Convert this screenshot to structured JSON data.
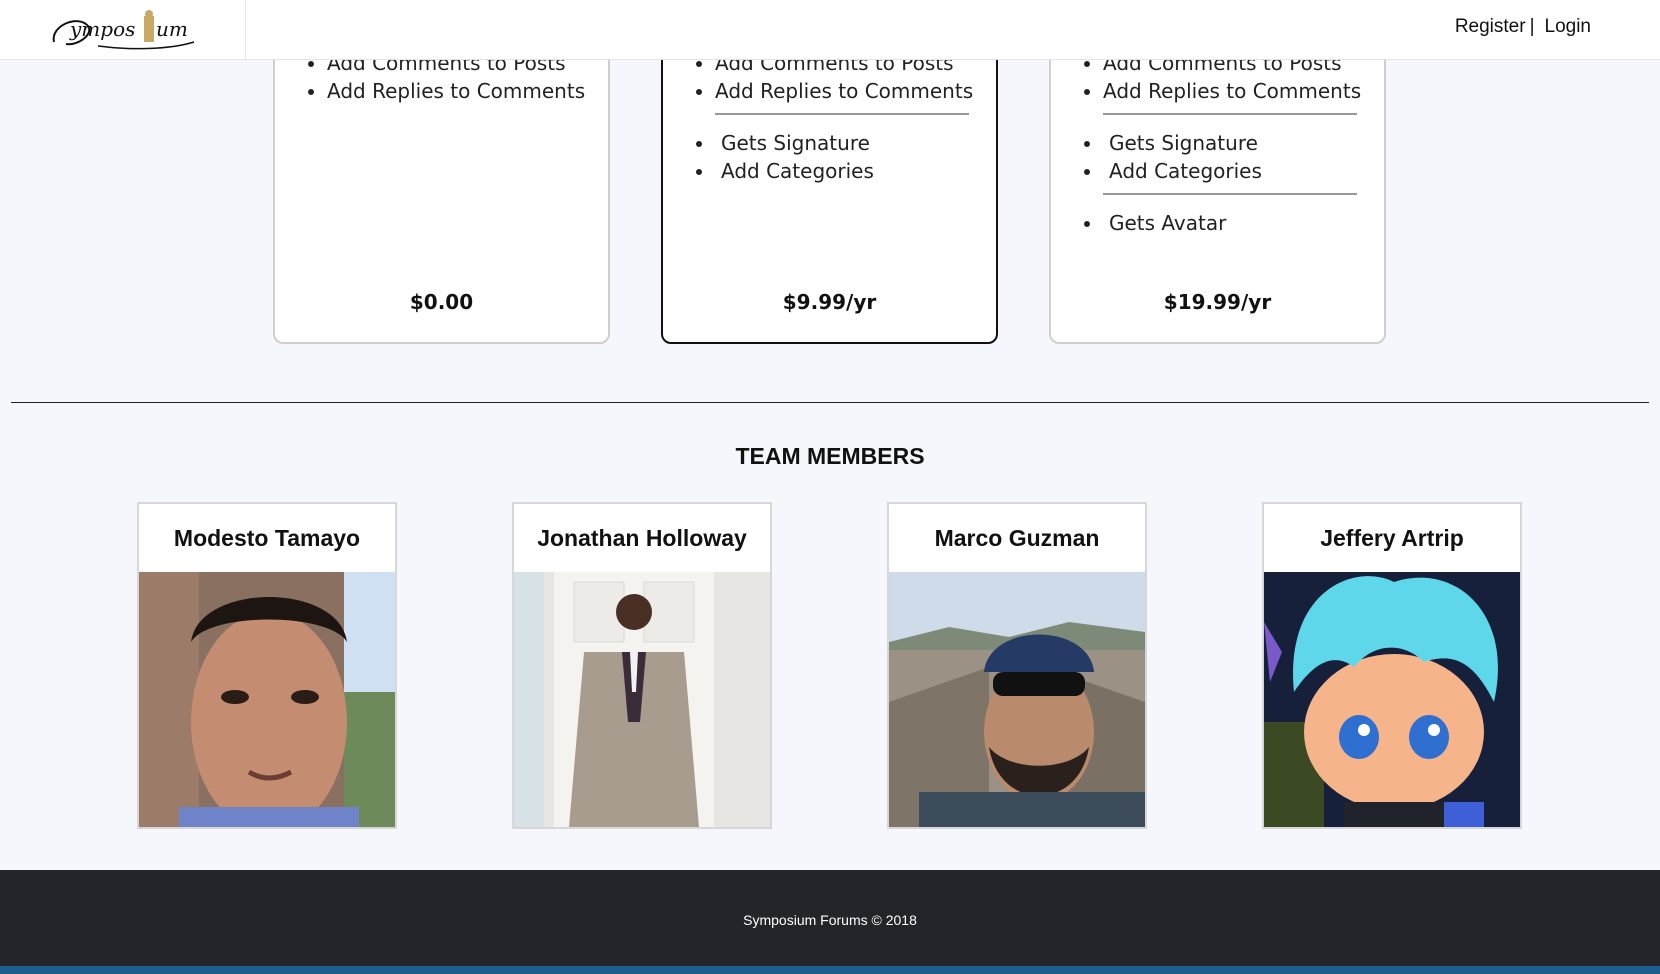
{
  "nav": {
    "brand": "Symposium",
    "register_label": "Register",
    "separator": "|",
    "login_label": "Login"
  },
  "plans": [
    {
      "features": [
        "Add Comments to Posts",
        "Add Replies to Comments"
      ],
      "price": "$0.00"
    },
    {
      "features": [
        "Add Comments to Posts",
        "Add Replies to Comments"
      ],
      "extra_features": [
        "Gets Signature",
        "Add Categories"
      ],
      "price": "$9.99/yr"
    },
    {
      "features": [
        "Add Comments to Posts",
        "Add Replies to Comments"
      ],
      "extra_features": [
        "Gets Signature",
        "Add Categories"
      ],
      "extra_features_2": [
        "Gets Avatar"
      ],
      "price": "$19.99/yr"
    }
  ],
  "team": {
    "title": "TEAM MEMBERS",
    "members": [
      {
        "name": "Modesto Tamayo"
      },
      {
        "name": "Jonathan Holloway"
      },
      {
        "name": "Marco Guzman"
      },
      {
        "name": "Jeffery Artrip"
      }
    ]
  },
  "footer": {
    "text": "Symposium Forums © 2018"
  },
  "colors": {
    "background": "#f5f7fc",
    "footer": "#23252b",
    "statusbar": "#1e5e8c"
  }
}
